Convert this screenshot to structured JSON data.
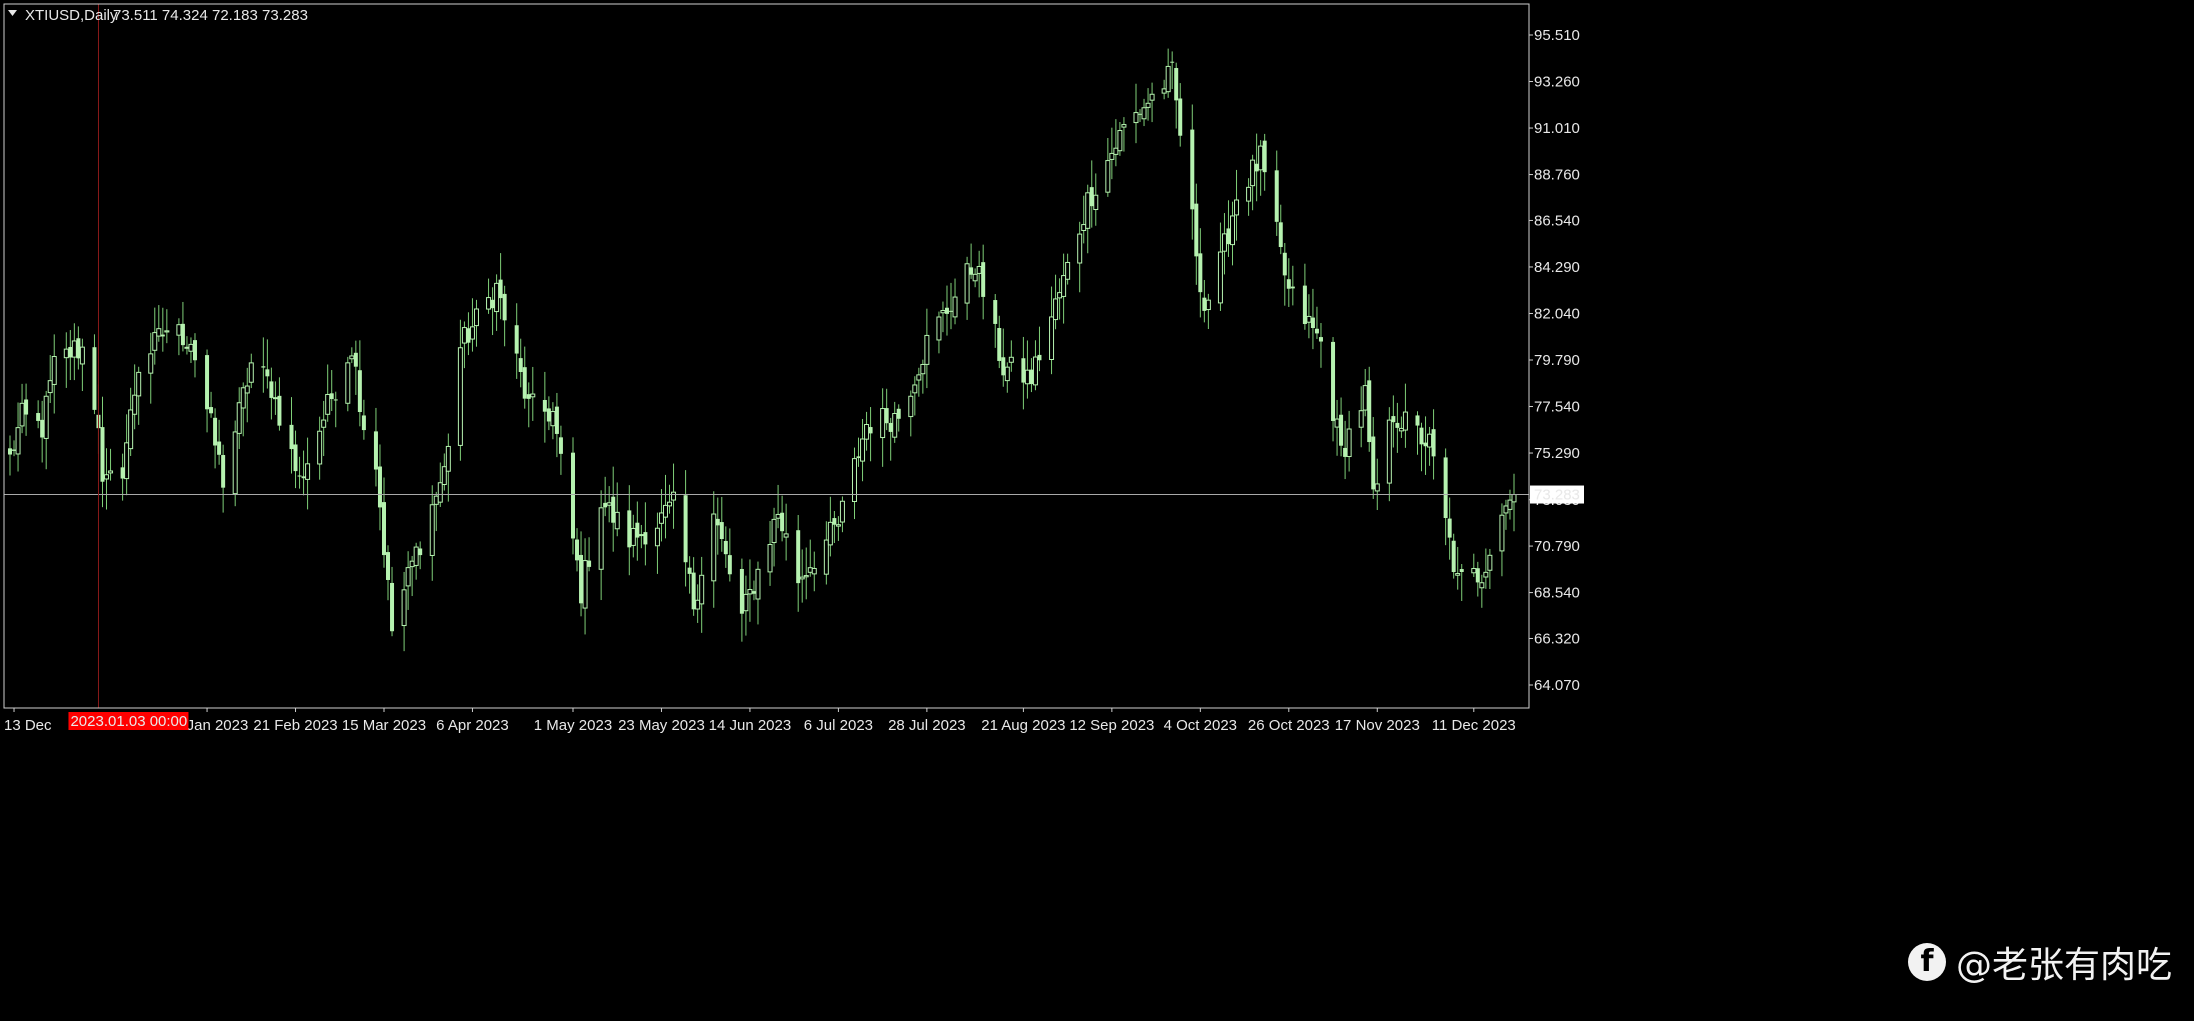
{
  "header": {
    "symbol": "XTIUSD,Daily",
    "ohlc": "73.511 74.324 72.183 73.283"
  },
  "colors": {
    "background": "#000000",
    "candle": "#b6f2b0",
    "wick": "#7fcf78",
    "border": "#cfcfcf",
    "price_line": "#a9a9a9",
    "crosshair": "#8b1a1a",
    "date_badge_bg": "#ff0000",
    "price_badge_bg": "#ffffff",
    "price_badge_text": "#000000"
  },
  "current_price_label": "73.283",
  "crosshair_date_label": "2023.01.03 00:00",
  "watermark": {
    "icon": "facebook-icon",
    "text": "@老张有肉吃"
  },
  "chart_data": {
    "type": "candlestick",
    "ylim": [
      64.07,
      96.5
    ],
    "current_price": 73.283,
    "y_ticks": [
      "95.510",
      "93.260",
      "91.010",
      "88.760",
      "86.540",
      "84.290",
      "82.040",
      "79.790",
      "77.540",
      "75.290",
      "73.030",
      "70.790",
      "68.540",
      "66.320",
      "64.070"
    ],
    "x_ticks": [
      "13 Dec 2022",
      "30 Jan 2023",
      "21 Feb 2023",
      "15 Mar 2023",
      "6 Apr 2023",
      "1 May 2023",
      "23 May 2023",
      "14 Jun 2023",
      "6 Jul 2023",
      "28 Jul 2023",
      "21 Aug 2023",
      "12 Sep 2023",
      "4 Oct 2023",
      "26 Oct 2023",
      "17 Nov 2023",
      "11 Dec 2023"
    ],
    "x_tick_labels": [
      "13 Dec",
      "30 Jan 2023",
      "21 Feb 2023",
      "15 Mar 2023",
      "6 Apr 2023",
      "1 May 2023",
      "23 May 2023",
      "14 Jun 2023",
      "6 Jul 2023",
      "28 Jul 2023",
      "21 Aug 2023",
      "12 Sep 2023",
      "4 Oct 2023",
      "26 Oct 2023",
      "17 Nov 2023",
      "11 Dec 2023"
    ],
    "x_start": "2022-12-12",
    "x_end": "2023-12-21",
    "crosshair_date": "2023-01-03",
    "anchors": [
      [
        "2022-12-12",
        75.0
      ],
      [
        "2022-12-15",
        77.0
      ],
      [
        "2022-12-20",
        76.5
      ],
      [
        "2022-12-23",
        79.5
      ],
      [
        "2022-12-28",
        80.3
      ],
      [
        "2022-12-30",
        80.3
      ],
      [
        "2023-01-03",
        76.9
      ],
      [
        "2023-01-04",
        73.5
      ],
      [
        "2023-01-09",
        74.6
      ],
      [
        "2023-01-13",
        79.5
      ],
      [
        "2023-01-20",
        81.3
      ],
      [
        "2023-01-26",
        80.8
      ],
      [
        "2023-02-03",
        74.0
      ],
      [
        "2023-02-10",
        79.6
      ],
      [
        "2023-02-15",
        78.5
      ],
      [
        "2023-02-22",
        73.9
      ],
      [
        "2023-02-28",
        77.0
      ],
      [
        "2023-03-07",
        80.5
      ],
      [
        "2023-03-10",
        76.7
      ],
      [
        "2023-03-13",
        74.8
      ],
      [
        "2023-03-17",
        66.7
      ],
      [
        "2023-03-22",
        69.9
      ],
      [
        "2023-03-30",
        74.4
      ],
      [
        "2023-04-03",
        80.4
      ],
      [
        "2023-04-12",
        83.3
      ],
      [
        "2023-04-20",
        77.5
      ],
      [
        "2023-04-26",
        77.2
      ],
      [
        "2023-05-03",
        68.6
      ],
      [
        "2023-05-08",
        73.0
      ],
      [
        "2023-05-15",
        71.1
      ],
      [
        "2023-05-22",
        71.9
      ],
      [
        "2023-05-26",
        72.7
      ],
      [
        "2023-05-31",
        68.0
      ],
      [
        "2023-06-05",
        72.3
      ],
      [
        "2023-06-12",
        67.3
      ],
      [
        "2023-06-21",
        72.4
      ],
      [
        "2023-06-26",
        69.2
      ],
      [
        "2023-07-06",
        71.8
      ],
      [
        "2023-07-13",
        76.7
      ],
      [
        "2023-07-21",
        77.1
      ],
      [
        "2023-07-28",
        80.6
      ],
      [
        "2023-08-09",
        84.5
      ],
      [
        "2023-08-16",
        79.4
      ],
      [
        "2023-08-23",
        78.9
      ],
      [
        "2023-08-31",
        83.6
      ],
      [
        "2023-09-06",
        87.5
      ],
      [
        "2023-09-15",
        91.0
      ],
      [
        "2023-09-27",
        93.6
      ],
      [
        "2023-10-05",
        82.3
      ],
      [
        "2023-10-09",
        84.4
      ],
      [
        "2023-10-13",
        87.7
      ],
      [
        "2023-10-19",
        89.5
      ],
      [
        "2023-10-26",
        83.0
      ],
      [
        "2023-11-03",
        80.6
      ],
      [
        "2023-11-08",
        75.3
      ],
      [
        "2023-11-14",
        78.1
      ],
      [
        "2023-11-16",
        72.9
      ],
      [
        "2023-11-21",
        77.2
      ],
      [
        "2023-11-30",
        75.7
      ],
      [
        "2023-12-07",
        69.0
      ],
      [
        "2023-12-13",
        69.5
      ],
      [
        "2023-12-18",
        72.5
      ],
      [
        "2023-12-21",
        73.28
      ]
    ]
  }
}
